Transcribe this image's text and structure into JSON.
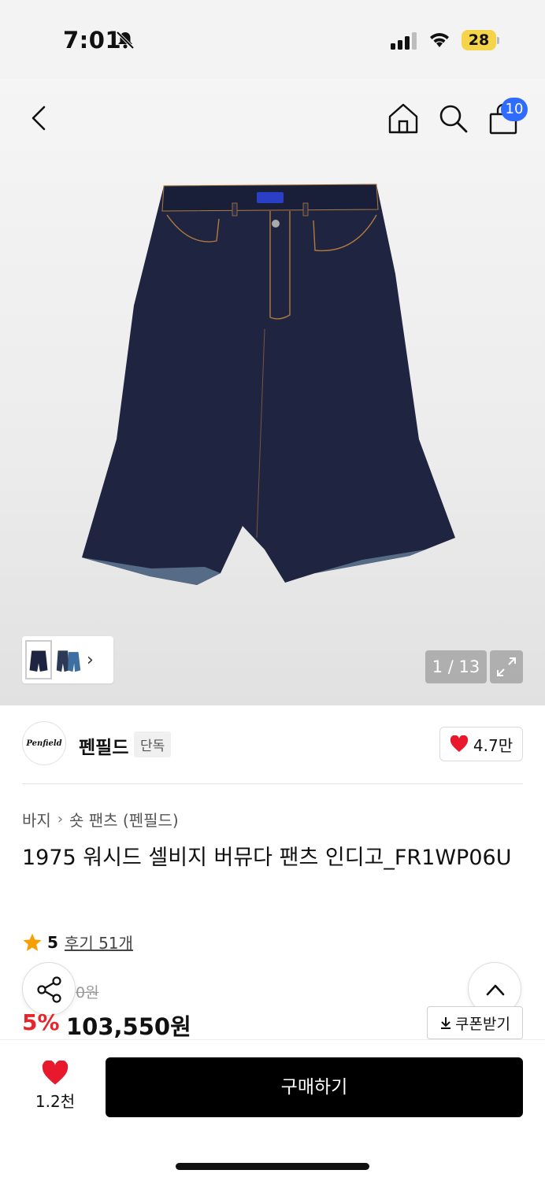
{
  "status_bar": {
    "time": "7:01",
    "battery": "28"
  },
  "header": {
    "cart_count": "10"
  },
  "gallery": {
    "page_counter": "1 / 13"
  },
  "brand": {
    "logo_text": "Penfield",
    "name": "펜필드",
    "badge": "단독",
    "like_count": "4.7만"
  },
  "breadcrumb": {
    "category": "바지",
    "subcategory": "숏 팬츠 (펜필드)"
  },
  "product": {
    "title": "1975 워시드 셀비지 버뮤다 팬츠 인디고_FR1WP06U",
    "rating": "5",
    "review_link": "후기 51개",
    "original_price": "0원",
    "discount_rate": "5%",
    "sale_price": "103,550원"
  },
  "coupon": {
    "label": "쿠폰받기"
  },
  "bottom_bar": {
    "wish_count": "1.2천",
    "buy_label": "구매하기"
  },
  "colors": {
    "accent_blue": "#2f6bff",
    "discount_red": "#e6262b",
    "heart_red": "#e8192c",
    "star_orange": "#f5a000",
    "buy_black": "#000000"
  },
  "icons": [
    "bell-slash-icon",
    "signal-icon",
    "wifi-icon",
    "back-arrow-icon",
    "home-icon",
    "search-icon",
    "cart-icon",
    "expand-icon",
    "heart-icon",
    "star-icon",
    "share-icon",
    "chevron-up-icon",
    "download-icon"
  ]
}
